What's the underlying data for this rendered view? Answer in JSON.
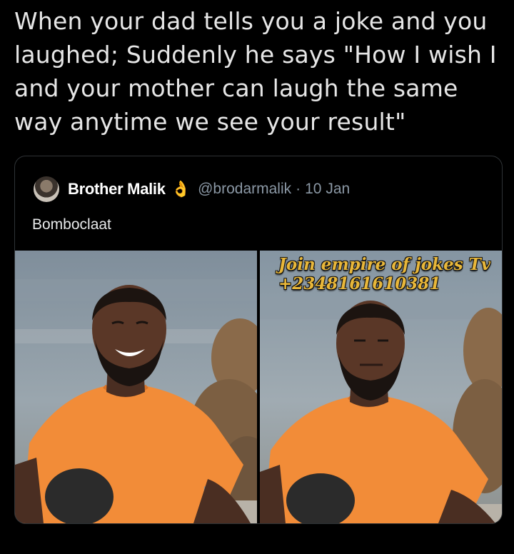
{
  "post": {
    "text": "When your dad tells you a joke and you laughed; Suddenly he says \"How I wish I and your mother can laugh the same way anytime we see your result\""
  },
  "quoted_tweet": {
    "display_name": "Brother Malik",
    "name_emoji": "👌",
    "handle": "@brodarmalik",
    "separator": "·",
    "date": "10 Jan",
    "text": "Bomboclaat"
  },
  "watermark": {
    "line1": "Join empire of jokes Tv",
    "line2": "+2348161610381"
  },
  "colors": {
    "background": "#000000",
    "text_primary": "#e7e9ea",
    "text_secondary": "#8b98a5",
    "border": "#2f3336",
    "shirt_orange": "#f28c38",
    "watermark": "#e8b73a"
  }
}
